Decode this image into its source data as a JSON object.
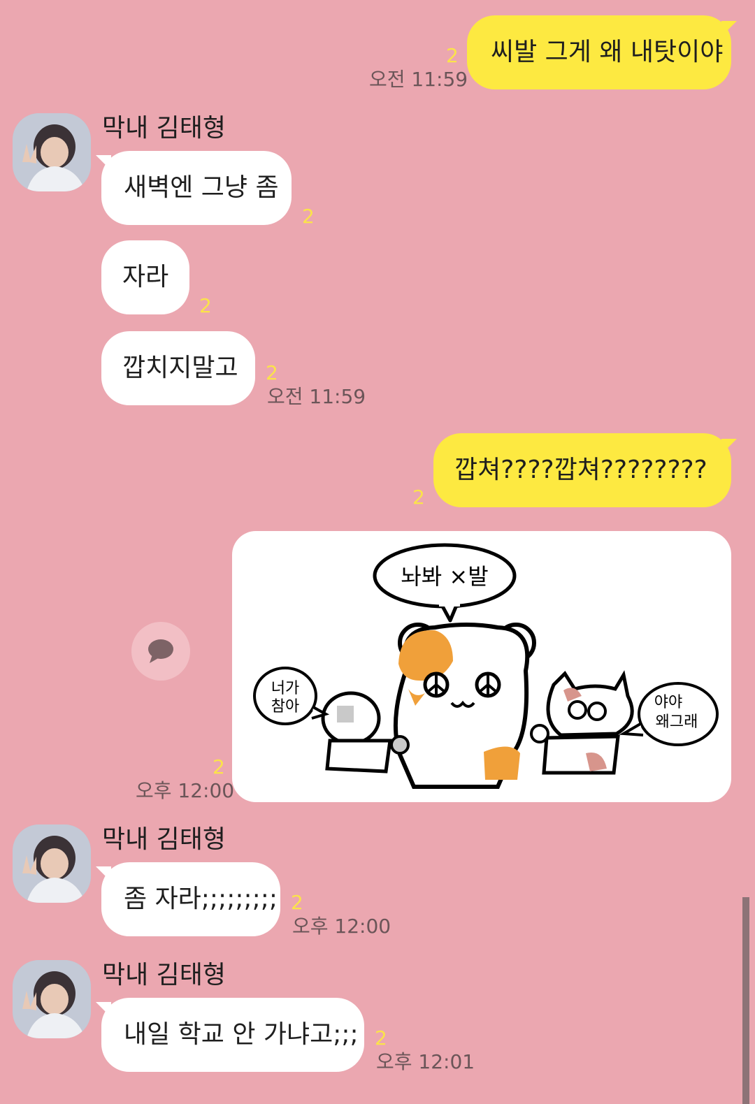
{
  "messages": {
    "m1": {
      "text": "씨발 그게 왜 내탓이야",
      "unread": "2",
      "time": "오전 11:59"
    },
    "m2": {
      "sender": "막내 김태형",
      "text": "새벽엔 그냥 좀",
      "unread": "2"
    },
    "m3": {
      "text": "자라",
      "unread": "2"
    },
    "m4": {
      "text": "깝치지말고",
      "unread": "2",
      "time": "오전 11:59"
    },
    "m5": {
      "text": "깝쳐????깝쳐????????",
      "unread": "2"
    },
    "m6": {
      "unread": "2",
      "time": "오후 12:00",
      "sticker": {
        "top_bubble": "놔봐 ×발",
        "left_bubble_line1": "너가",
        "left_bubble_line2": "참아",
        "right_bubble_line1": "야야",
        "right_bubble_line2": "왜그래"
      }
    },
    "m7": {
      "sender": "막내 김태형",
      "text": "좀 자라;;;;;;;;;",
      "unread": "2",
      "time": "오후 12:00"
    },
    "m8": {
      "sender": "막내 김태형",
      "text": "내일 학교 안 가냐고;;;",
      "unread": "2",
      "time": "오후 12:01"
    }
  },
  "icons": {
    "reply": "speech-bubble-icon"
  },
  "colors": {
    "background": "#eba7b0",
    "my_bubble": "#fde941",
    "their_bubble": "#ffffff",
    "unread": "#fbe34a"
  }
}
